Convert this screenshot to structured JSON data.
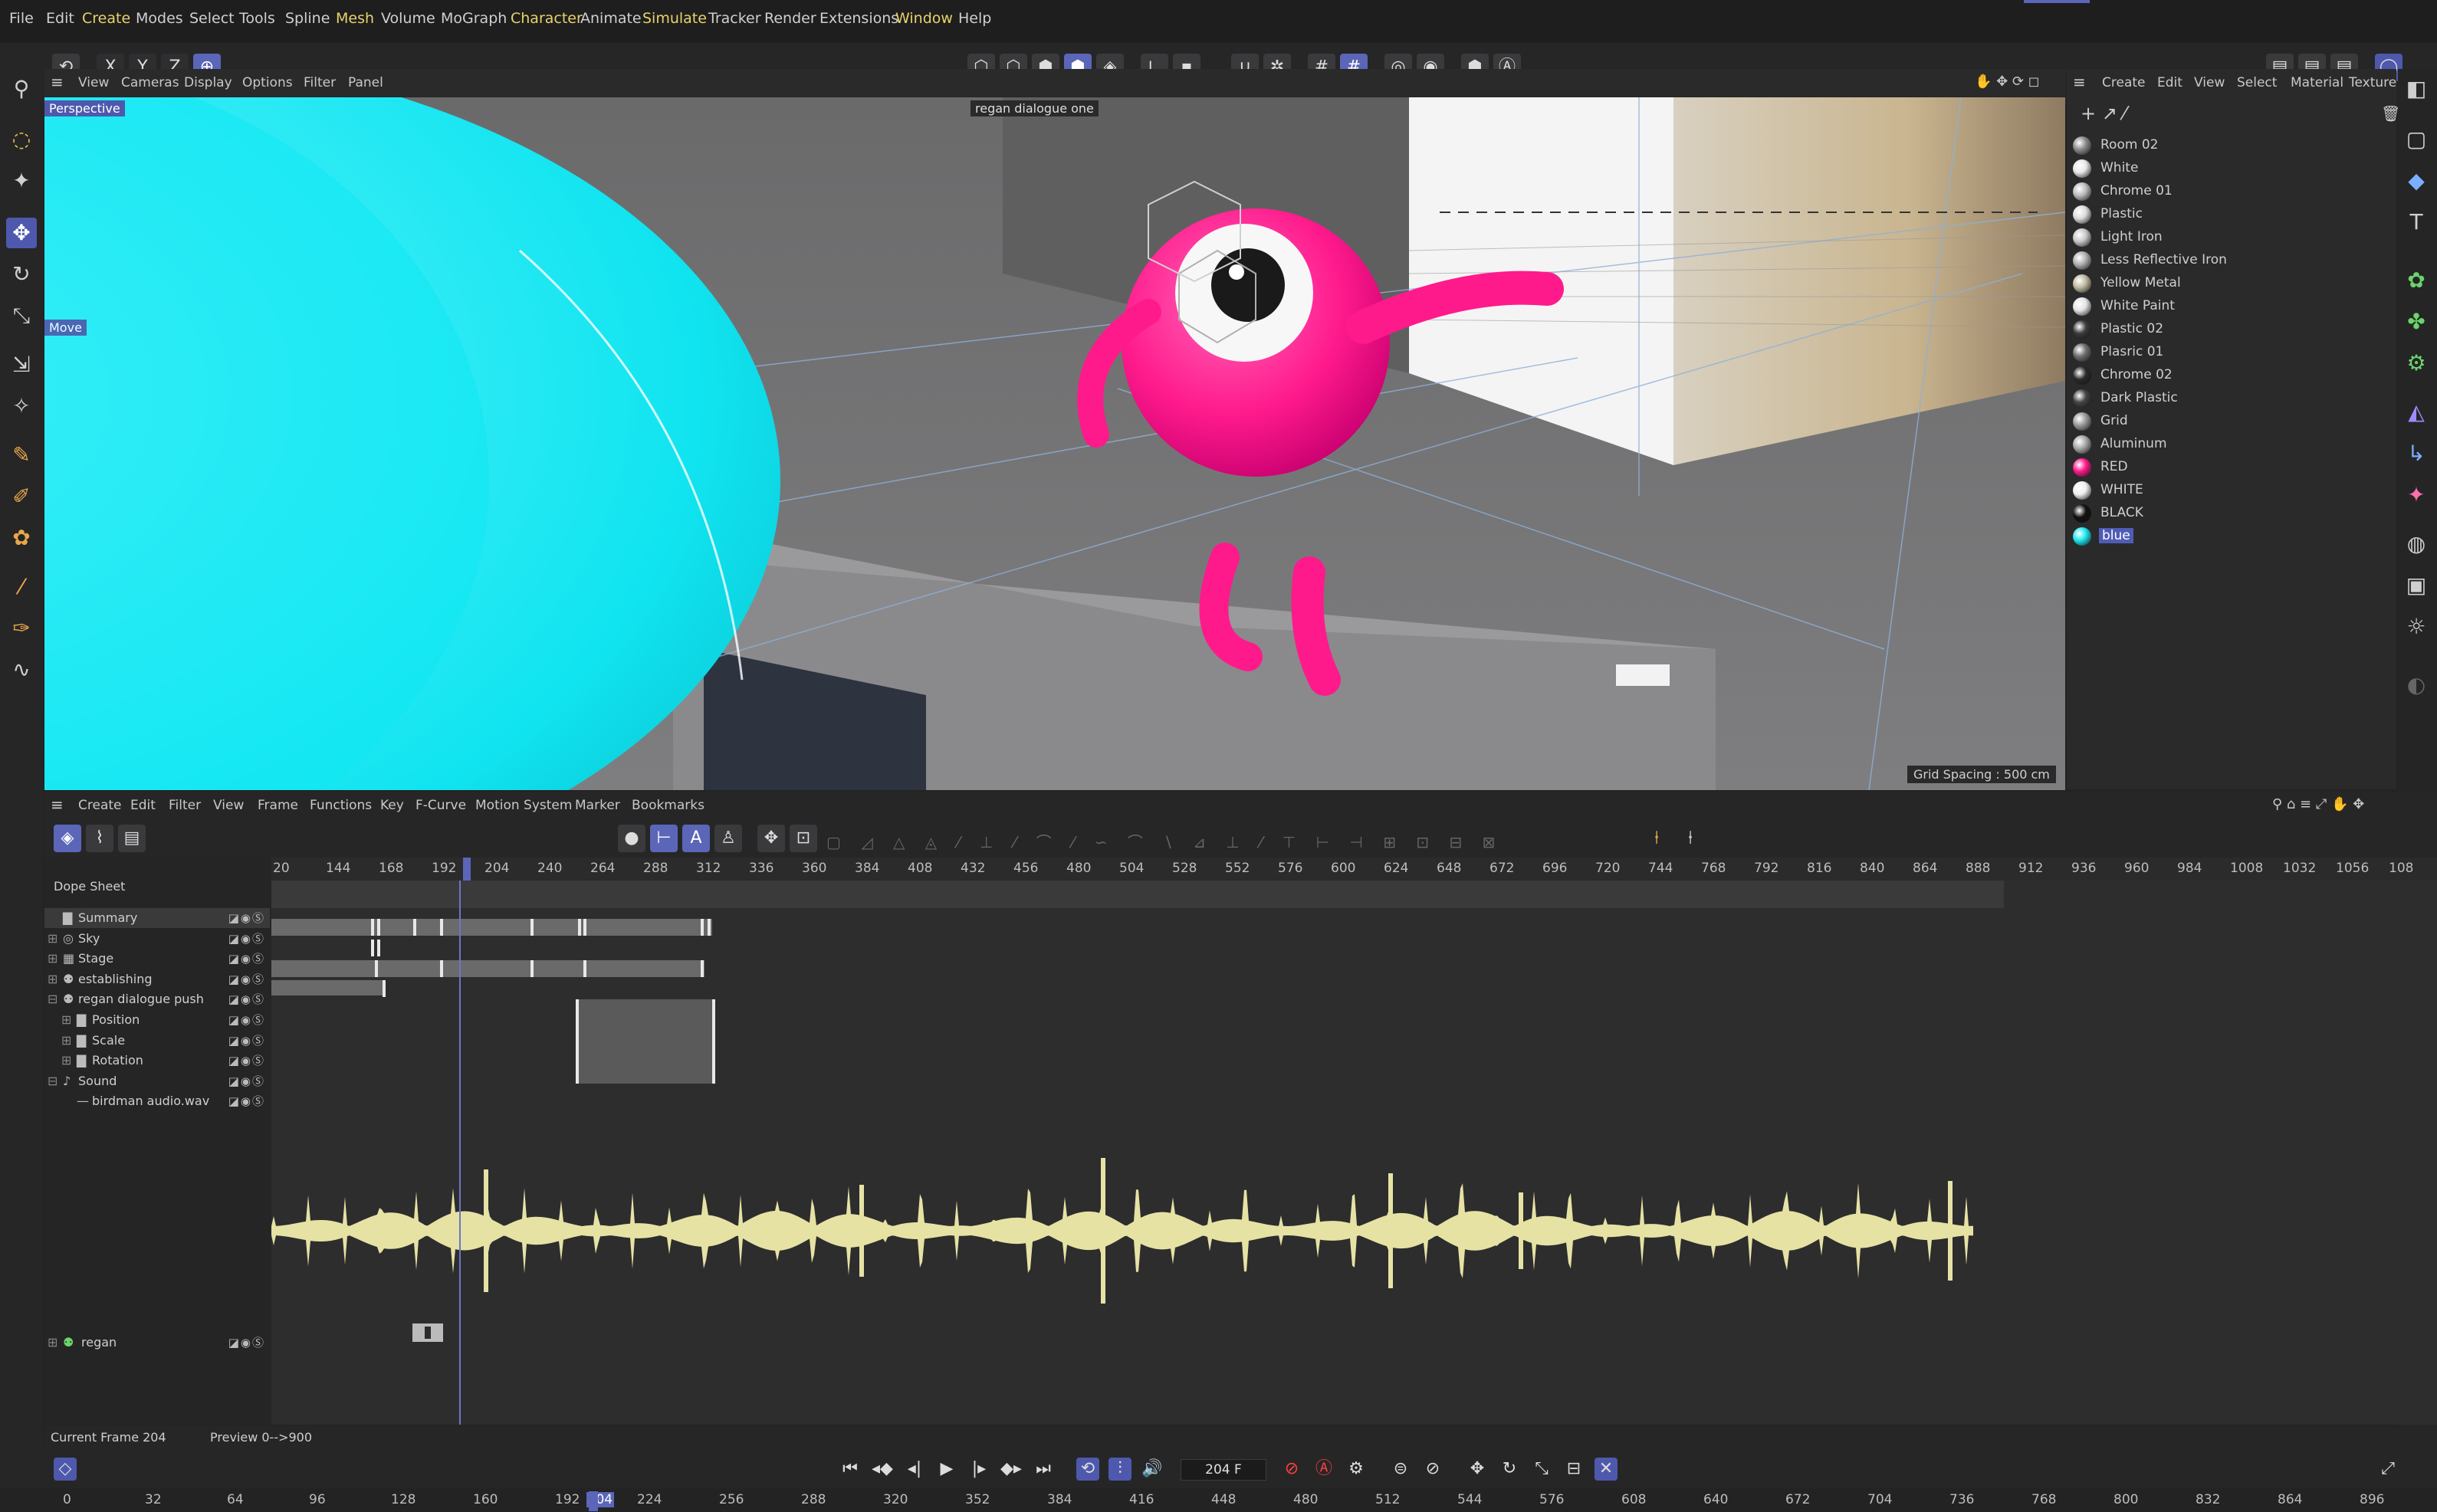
{
  "menu": [
    "File",
    "Edit",
    "Create",
    "Modes",
    "Select",
    "Tools",
    "Spline",
    "Mesh",
    "Volume",
    "MoGraph",
    "Character",
    "Animate",
    "Simulate",
    "Tracker",
    "Render",
    "Extensions",
    "Window",
    "Help"
  ],
  "axis_buttons": [
    "X",
    "Y",
    "Z"
  ],
  "viewport": {
    "menu": [
      "View",
      "Cameras",
      "Display",
      "Options",
      "Filter",
      "Panel"
    ],
    "label": "Perspective",
    "camera_label": "regan dialogue one",
    "move_label": "Move",
    "grid_spacing": "Grid Spacing : 500 cm"
  },
  "materials": {
    "menu": [
      "Create",
      "Edit",
      "View",
      "Select",
      "Material",
      "Texture"
    ],
    "items": [
      {
        "name": "Room 02",
        "color": "#8a8a8a"
      },
      {
        "name": "White",
        "color": "#e8e8e8"
      },
      {
        "name": "Chrome 01",
        "color": "#bcbcbc"
      },
      {
        "name": "Plastic",
        "color": "#dcdcdc"
      },
      {
        "name": "Light Iron",
        "color": "#c8c8c8"
      },
      {
        "name": "Less Reflective Iron",
        "color": "#b0b0b0"
      },
      {
        "name": "Yellow Metal",
        "color": "#c0b9a0"
      },
      {
        "name": "White Paint",
        "color": "#e4e4e4"
      },
      {
        "name": "Plastic 02",
        "color": "#3c3c3c"
      },
      {
        "name": "Plasric 01",
        "color": "#6e6e6e"
      },
      {
        "name": "Chrome 02",
        "color": "#2a2a2a"
      },
      {
        "name": "Dark Plastic",
        "color": "#444444"
      },
      {
        "name": "Grid",
        "color": "#999999"
      },
      {
        "name": "Aluminum",
        "color": "#a8a8a8"
      },
      {
        "name": "RED",
        "color": "#ff1a8c"
      },
      {
        "name": "WHITE",
        "color": "#f0f0f0"
      },
      {
        "name": "BLACK",
        "color": "#111111"
      },
      {
        "name": "blue",
        "color": "#1de8f0"
      }
    ],
    "selected": "blue"
  },
  "timeline": {
    "menu": [
      "Create",
      "Edit",
      "Filter",
      "View",
      "Frame",
      "Functions",
      "Key",
      "F-Curve",
      "Motion System",
      "Marker",
      "Bookmarks"
    ],
    "mode_label": "Dope Sheet",
    "ruler_ticks": [
      "20",
      "144",
      "168",
      "192",
      "204",
      "240",
      "264",
      "288",
      "312",
      "336",
      "360",
      "384",
      "408",
      "432",
      "456",
      "480",
      "504",
      "528",
      "552",
      "576",
      "600",
      "624",
      "648",
      "672",
      "696",
      "720",
      "744",
      "768",
      "792",
      "816",
      "840",
      "864",
      "888",
      "912",
      "936",
      "960",
      "984",
      "1008",
      "1032",
      "1056",
      "108"
    ],
    "tracks": [
      {
        "name": "Summary",
        "indent": 0
      },
      {
        "name": "Sky",
        "indent": 0
      },
      {
        "name": "Stage",
        "indent": 0
      },
      {
        "name": "establishing",
        "indent": 0
      },
      {
        "name": "regan dialogue push",
        "indent": 0
      },
      {
        "name": "Position",
        "indent": 1
      },
      {
        "name": "Scale",
        "indent": 1
      },
      {
        "name": "Rotation",
        "indent": 1
      },
      {
        "name": "Sound",
        "indent": 0
      },
      {
        "name": "birdman audio.wav",
        "indent": 1
      }
    ],
    "regan_track": "regan",
    "status_current": "Current Frame  204",
    "status_preview": "Preview  0-->900"
  },
  "transport": {
    "frame_value": "204 F"
  },
  "bottom_ruler": [
    "0",
    "32",
    "64",
    "96",
    "128",
    "160",
    "192",
    "204",
    "224",
    "256",
    "288",
    "320",
    "352",
    "384",
    "416",
    "448",
    "480",
    "512",
    "544",
    "576",
    "608",
    "640",
    "672",
    "704",
    "736",
    "768",
    "800",
    "832",
    "864",
    "896"
  ],
  "colors": {
    "accent": "#5b66b8",
    "waveform": "#e6e2a4",
    "character_pink": "#ff1a8c",
    "sphere_cyan": "#1de8f0"
  }
}
